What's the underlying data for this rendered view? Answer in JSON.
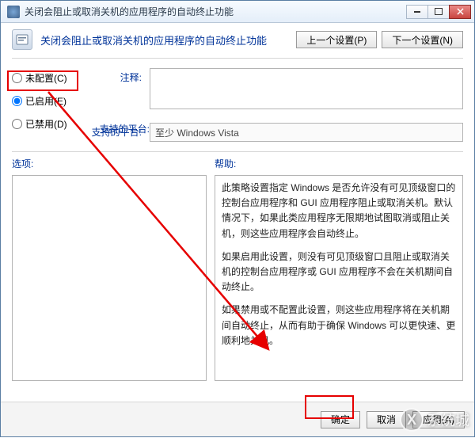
{
  "titlebar": {
    "title": "关闭会阻止或取消关机的应用程序的自动终止功能"
  },
  "header": {
    "title": "关闭会阻止或取消关机的应用程序的自动终止功能",
    "prev_btn": "上一个设置(P)",
    "next_btn": "下一个设置(N)"
  },
  "radios": {
    "not_configured": "未配置(C)",
    "enabled": "已启用(E)",
    "disabled": "已禁用(D)"
  },
  "labels": {
    "comment": "注释:",
    "platform": "支持的平台:",
    "options": "选项:",
    "help": "帮助:"
  },
  "platform_value": "至少 Windows Vista",
  "help_paragraphs": [
    "此策略设置指定 Windows 是否允许没有可见顶级窗口的控制台应用程序和 GUI 应用程序阻止或取消关机。默认情况下，如果此类应用程序无限期地试图取消或阻止关机，则这些应用程序会自动终止。",
    "如果启用此设置，则没有可见顶级窗口且阻止或取消关机的控制台应用程序或 GUI 应用程序不会在关机期间自动终止。",
    "如果禁用或不配置此设置，则这些应用程序将在关机期间自动终止，从而有助于确保 Windows 可以更快速、更顺利地关机。"
  ],
  "footer": {
    "ok": "确定",
    "cancel": "取消",
    "apply": "应用(A)"
  },
  "watermark": "系统城"
}
